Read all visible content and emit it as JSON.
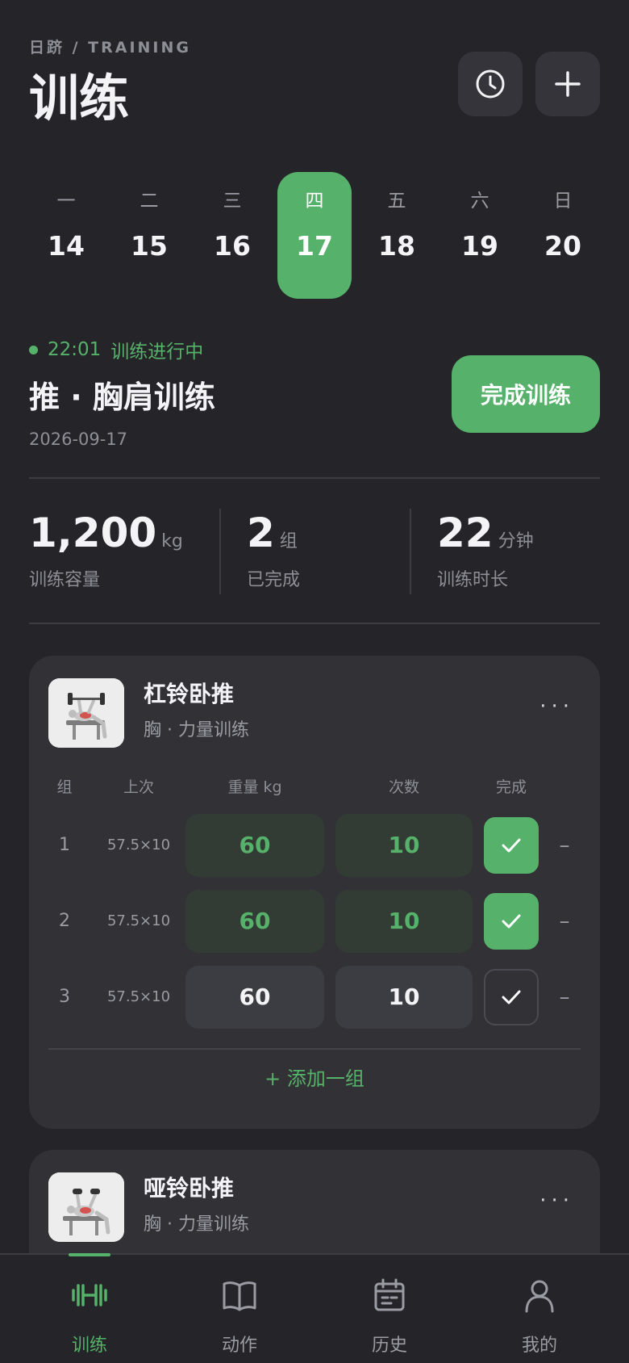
{
  "header": {
    "brand": "日跻 / TRAINING",
    "title": "训练",
    "history_icon": "clock-icon",
    "add_icon": "plus-icon"
  },
  "week": {
    "days": [
      {
        "dow": "一",
        "num": "14",
        "active": false
      },
      {
        "dow": "二",
        "num": "15",
        "active": false
      },
      {
        "dow": "三",
        "num": "16",
        "active": false
      },
      {
        "dow": "四",
        "num": "17",
        "active": true
      },
      {
        "dow": "五",
        "num": "18",
        "active": false
      },
      {
        "dow": "六",
        "num": "19",
        "active": false
      },
      {
        "dow": "日",
        "num": "20",
        "active": false
      }
    ]
  },
  "session": {
    "elapsed": "22:01",
    "status": "训练进行中",
    "title": "推 · 胸肩训练",
    "date": "2026-09-17",
    "finish_label": "完成训练"
  },
  "stats": [
    {
      "value": "1,200",
      "unit": "kg",
      "label": "训练容量"
    },
    {
      "value": "2",
      "unit": "组",
      "label": "已完成"
    },
    {
      "value": "22",
      "unit": "分钟",
      "label": "训练时长"
    }
  ],
  "table_headers": {
    "set": "组",
    "previous": "上次",
    "weight": "重量 kg",
    "reps": "次数",
    "done": "完成"
  },
  "exercises": [
    {
      "name": "杠铃卧推",
      "category": "胸 · 力量训练",
      "more": "···",
      "sets": [
        {
          "index": "1",
          "previous": "57.5×10",
          "weight": "60",
          "reps": "10",
          "done": true,
          "remove": "–"
        },
        {
          "index": "2",
          "previous": "57.5×10",
          "weight": "60",
          "reps": "10",
          "done": true,
          "remove": "–"
        },
        {
          "index": "3",
          "previous": "57.5×10",
          "weight": "60",
          "reps": "10",
          "done": false,
          "remove": "–"
        }
      ],
      "add_set_label": "+ 添加一组"
    },
    {
      "name": "哑铃卧推",
      "category": "胸 · 力量训练",
      "more": "···"
    }
  ],
  "nav": [
    {
      "label": "训练",
      "icon": "dumbbell-icon",
      "active": true
    },
    {
      "label": "动作",
      "icon": "book-icon",
      "active": false
    },
    {
      "label": "历史",
      "icon": "calendar-icon",
      "active": false
    },
    {
      "label": "我的",
      "icon": "person-icon",
      "active": false
    }
  ],
  "colors": {
    "accent": "#56b26a",
    "background": "#252529",
    "card": "#313136"
  }
}
